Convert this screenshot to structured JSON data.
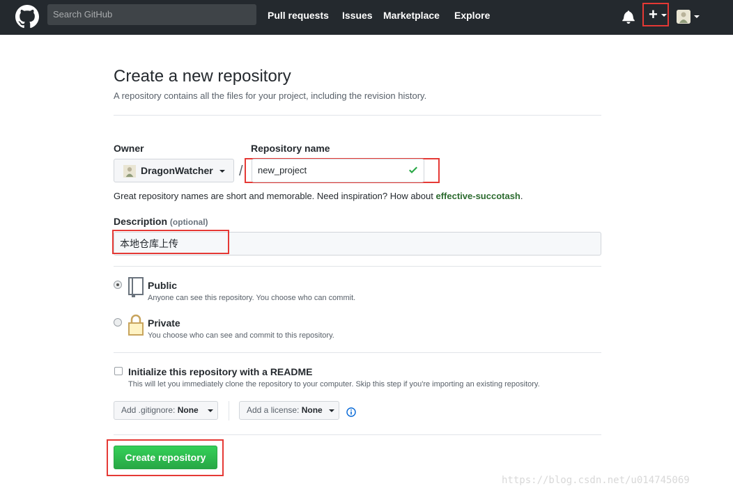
{
  "header": {
    "search_placeholder": "Search GitHub",
    "nav": [
      "Pull requests",
      "Issues",
      "Marketplace",
      "Explore"
    ],
    "plus_icon": "plus-icon",
    "colors": {
      "bg": "#24292e",
      "highlight": "#e53935"
    }
  },
  "page": {
    "title": "Create a new repository",
    "subtitle": "A repository contains all the files for your project, including the revision history."
  },
  "owner": {
    "label": "Owner",
    "name": "DragonWatcher"
  },
  "repo": {
    "label": "Repository name",
    "value": "new_project",
    "valid_icon": "check-icon"
  },
  "hint": {
    "text": "Great repository names are short and memorable. Need inspiration? How about",
    "suggestion": "effective-succotash",
    "end": "."
  },
  "description": {
    "label": "Description",
    "optional": "(optional)",
    "value": "本地仓库上传"
  },
  "visibility": {
    "public": {
      "title": "Public",
      "note": "Anyone can see this repository. You choose who can commit.",
      "selected": true
    },
    "private": {
      "title": "Private",
      "note": "You choose who can see and commit to this repository.",
      "selected": false
    }
  },
  "readme": {
    "title": "Initialize this repository with a README",
    "note": "This will let you immediately clone the repository to your computer. Skip this step if you're importing an existing repository."
  },
  "gitignore": {
    "label": "Add .gitignore:",
    "value": "None"
  },
  "license": {
    "label": "Add a license:",
    "value": "None"
  },
  "submit": {
    "label": "Create repository",
    "color": "#2cbe4e"
  },
  "watermark": "https://blog.csdn.net/u014745069"
}
